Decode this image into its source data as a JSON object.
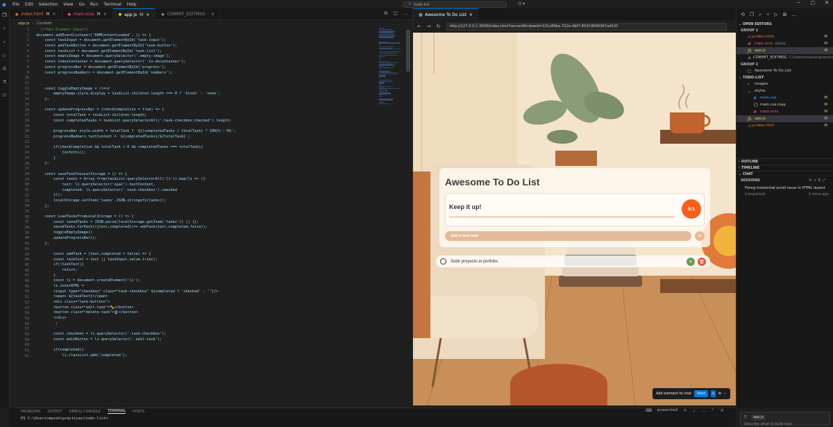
{
  "titlebar": {
    "menu": [
      "File",
      "Edit",
      "Selection",
      "View",
      "Go",
      "Run",
      "Terminal",
      "Help"
    ],
    "search": "todo-list"
  },
  "tabs": [
    {
      "label": "index.html",
      "mod": "M",
      "color": "#e37933"
    },
    {
      "label": "main.scss",
      "mod": "M",
      "color": "#f55385"
    },
    {
      "label": "app.js",
      "mod": "M",
      "color": "#e8d44d"
    },
    {
      "label": "COMMIT_EDITMSG",
      "mod": "",
      "color": "#888"
    }
  ],
  "breadcrumb": [
    "app.js",
    "Confetti"
  ],
  "code_lines": [
    "  //*Get Element Input*/",
    "document.addEventListener('DOMContentLoaded', () => {",
    "    const taskInput = document.getElementById('task-input');",
    "    const addTaskButton = document.getElementById('task-button');",
    "    const taskList = document.getElementById('task-list');",
    "    const emptyImage = document.querySelector('.empty-image');",
    "    const todosContainer = document.querySelector('.to-docontainer');",
    "    const progressBar = document.getElementById('progress');",
    "    const progressNumbers = document.getElementById('numbers');",
    "",
    "",
    "    const toggleEmptyImage = ()=>{",
    "        emptyImage.style.display = taskList.children.length === 0 ? 'block' : 'none';",
    "    };",
    "",
    "    const updateProgressBar = (checkCompletion = true) => {",
    "        const totalTask = taskList.children.length;",
    "        const completedTasks = taskList.querySelectorAll('.task-checkbox:checked').length;",
    "",
    "        progressBar.style.width = totalTask ? `${(completedTasks / totalTask) * 100}%`:'0%';",
    "        progressNumbers.textContent = `${completedTasks}/${totalTask}`;",
    "",
    "        if(checkCompletion && totalTask > 0 && completedTasks === totalTask){",
    "            Confetti();",
    "        }",
    "    };",
    "",
    "    const saveTaskToLocalStorage = () => {",
    "        const tasks = Array.from(taskList.querySelectorAll('li')).map(li => ({",
    "            text: li.querySelector('span').textContent,",
    "            completed: li.querySelector('.task-checkbox').checked",
    "        }));",
    "        localStorage.setItem('tasks',JSON.stringify(tasks));",
    "    };",
    "",
    "    const LoadTasksFromLocalStorage = () => {",
    "        const savedTasks = JSON.parse(localStorage.getItem('tasks')) || [];",
    "        savedTasks.forEach(({text,completed})=> addTask(text,completed,false));",
    "        toggleEmptyImage()",
    "        updateProgressBar();",
    "    };",
    "",
    "        const addTask = (text,completed = false) => {",
    "        const taskText = text || taskInput.value.trim();",
    "        if(!taskText){",
    "            return;",
    "        }",
    "        const li = document.createElement('li');",
    "        li.innerHTML = `",
    "        <input type=\"checkbox\" class=\"task-checkbox\" ${completed ? 'checked' : ''}/>",
    "        <span> ${taskText}</span>",
    "        <div class=\"task-buttons\">",
    "        <button class=\"edit-task\">✏️</button>",
    "        <button class=\"delete-task\">🗑️</button>",
    "        </div>",
    "        `;",
    "",
    "        const checkbox = li.querySelector('.task-checkbox');",
    "        const editButton = li.querySelector('.edit-task');",
    "",
    "        if(completed){",
    "            li.classList.add('completed');"
  ],
  "panel": {
    "tabs": [
      "PROBLEMS",
      "OUTPUT",
      "DEBUG CONSOLE",
      "TERMINAL",
      "PORTS"
    ],
    "active_tab": "TERMINAL",
    "prompt": "PS C:\\Users\\maxsk\\practicas\\todo-list>",
    "shell": "powershell"
  },
  "browser": {
    "tab_title": "Awesome To Do List",
    "url": "http://127.0.0.1:3000/index.html?serverWindowId=321c89be-722a-4bf7-852f-9690367ad520"
  },
  "app": {
    "title": "Awesome To Do List",
    "stats_text": "Keep it up!",
    "counter": "0/1",
    "progress": 0.0,
    "input_placeholder": "Add a new task",
    "add_button": "+",
    "task": "Subir proyecto al portfolio",
    "add_to_chat": "Add element to chat",
    "start": "Start"
  },
  "sidebar": {
    "open_editors_title": "OPEN EDITORS",
    "group1": "GROUP 1",
    "group1_items": [
      {
        "label": "index.html",
        "desc": "",
        "mod": "M",
        "color": "#e37933",
        "icon": "<>"
      },
      {
        "label": "main.scss",
        "desc": "styles",
        "mod": "M",
        "color": "#f55385",
        "icon": "#"
      },
      {
        "label": "app.js",
        "desc": "",
        "mod": "M",
        "color": "#e8d44d",
        "icon": "JS"
      },
      {
        "label": "COMMIT_EDITMSG",
        "desc": "C:\\Users\\maxsk\\practicas",
        "mod": "",
        "color": "#aaa",
        "icon": "≡"
      }
    ],
    "group2": "GROUP 2",
    "group2_items": [
      {
        "label": "Awesome To Do List",
        "desc": "",
        "mod": "",
        "color": "#aaa",
        "icon": "▢"
      }
    ],
    "project_title": "TODO-LIST",
    "tree": [
      {
        "label": "images",
        "mod": "",
        "color": "#ccc",
        "icon": "›",
        "indent": 0
      },
      {
        "label": "styles",
        "mod": "",
        "color": "#ccc",
        "icon": "⌄",
        "indent": 0
      },
      {
        "label": "main.css",
        "mod": "M",
        "color": "#42a5f5",
        "icon": "#",
        "indent": 1
      },
      {
        "label": "main.css.map",
        "mod": "M",
        "color": "#aaa",
        "icon": "{}",
        "indent": 1
      },
      {
        "label": "main.scss",
        "mod": "M",
        "color": "#f55385",
        "icon": "#",
        "indent": 1
      },
      {
        "label": "app.js",
        "mod": "M",
        "color": "#e8d44d",
        "icon": "JS",
        "indent": 0
      },
      {
        "label": "index.html",
        "mod": "M",
        "color": "#e37933",
        "icon": "<>",
        "indent": 0
      }
    ],
    "outline": "OUTLINE",
    "timeline": "TIMELINE",
    "chat": "CHAT",
    "sessions": "SESSIONS",
    "session_title": "Fixing horizontal scroll issue in HTML layout",
    "session_status": "Completed",
    "session_time": "2 mins ago",
    "chat_placeholder": "Describe what to build next",
    "chat_file": "app.js"
  }
}
